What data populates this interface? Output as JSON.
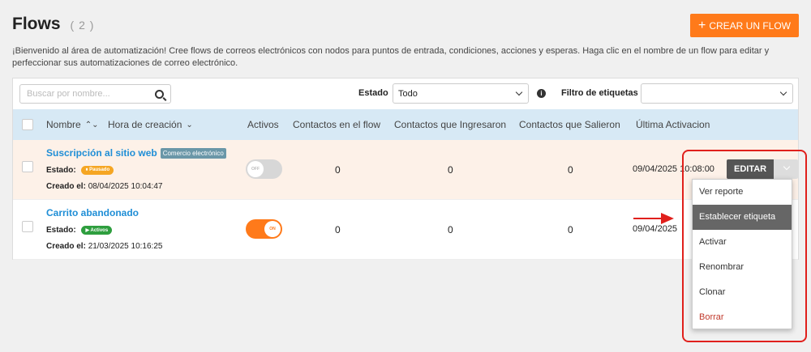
{
  "header": {
    "title": "Flows",
    "count": "( 2 )",
    "create_label": "CREAR UN FLOW"
  },
  "intro": "¡Bienvenido al área de automatización! Cree flows de correos electrónicos con nodos para puntos de entrada, condiciones, acciones y esperas. Haga clic en el nombre de un flow para editar y perfeccionar sus automatizaciones de correo electrónico.",
  "filters": {
    "search_placeholder": "Buscar por nombre...",
    "estado_label": "Estado",
    "estado_value": "Todo",
    "tags_label": "Filtro de etiquetas"
  },
  "columns": {
    "nombre": "Nombre",
    "hora": "Hora de creación",
    "activos": "Activos",
    "contactos": "Contactos en el flow",
    "ingresaron": "Contactos que Ingresaron",
    "salieron": "Contactos que Salieron",
    "ultima": "Última Activacion"
  },
  "labels": {
    "estado": "Estado:",
    "creado": "Creado el:",
    "edit": "EDITAR"
  },
  "rows": [
    {
      "name": "Suscripción al sitio web",
      "tag": "Comercio electrónico",
      "status": "⏸ Pausado",
      "created": "08/04/2025 10:04:47",
      "toggle": "OFF",
      "contactos": "0",
      "ingresaron": "0",
      "salieron": "0",
      "last": "09/04/2025 10:08:00"
    },
    {
      "name": "Carrito abandonado",
      "status": "▶ Activos",
      "created": "21/03/2025 10:16:25",
      "toggle": "ON",
      "contactos": "0",
      "ingresaron": "0",
      "salieron": "0",
      "last": "09/04/2025"
    }
  ],
  "menu": {
    "items": [
      "Ver reporte",
      "Establecer etiqueta",
      "Activar",
      "Renombrar",
      "Clonar",
      "Borrar"
    ]
  },
  "colors": {
    "accent": "#ff7a1a",
    "link": "#1f8ed6",
    "annotation": "#e0201c"
  }
}
